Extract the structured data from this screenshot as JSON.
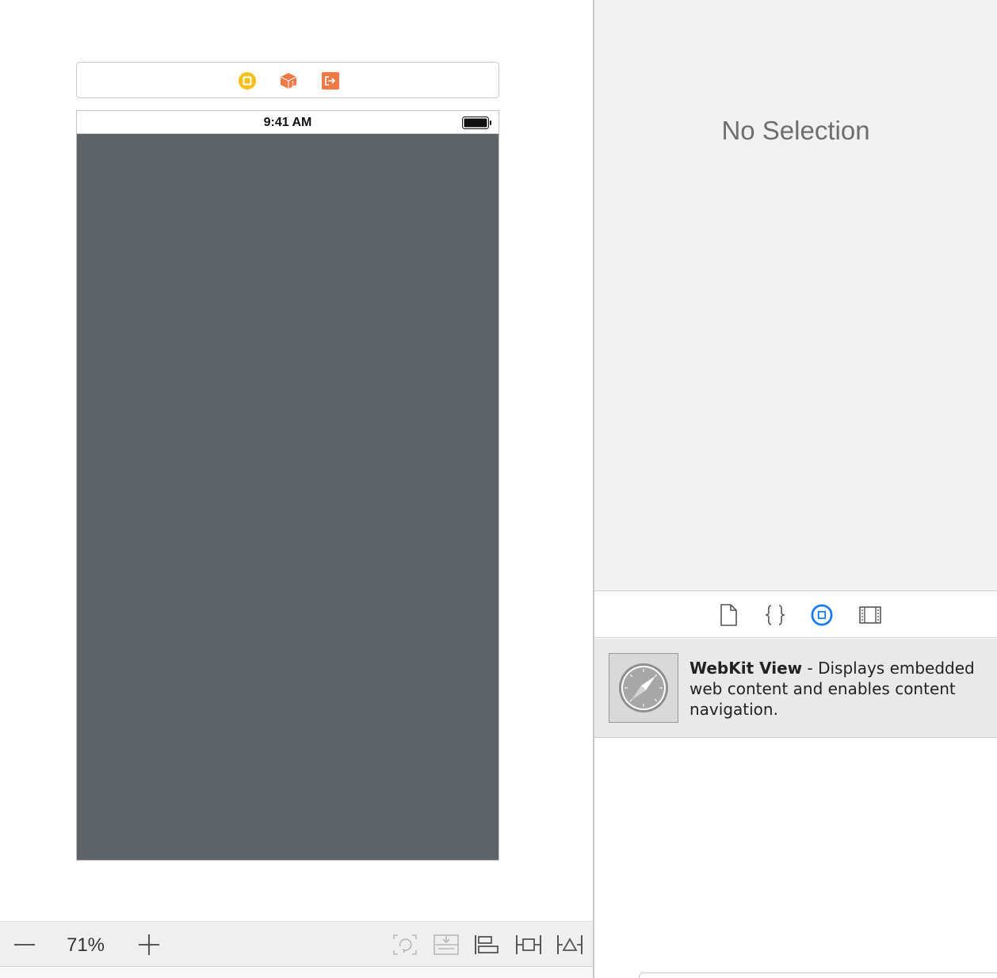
{
  "canvas": {
    "status_bar": {
      "time": "9:41 AM"
    },
    "scene_dock": {
      "icons": [
        "view-controller-icon",
        "first-responder-icon",
        "exit-icon"
      ],
      "colors": {
        "view_controller": "#f5c018",
        "first_responder": "#ef7a45",
        "exit": "#ef7a45"
      }
    },
    "view_background": "#5d6366",
    "toolbar": {
      "zoom_level": "71%",
      "buttons": [
        "zoom-out-icon",
        "zoom-in-icon",
        "update-frames-icon",
        "embed-in-stack-icon",
        "align-icon",
        "add-constraints-icon",
        "resolve-issues-icon"
      ]
    }
  },
  "inspector": {
    "empty_message": "No Selection"
  },
  "library": {
    "tabs": [
      "file-template-icon",
      "code-snippet-icon",
      "object-library-icon",
      "media-library-icon"
    ],
    "active_tab": "object-library-icon",
    "accent": "#1a7cf0",
    "item": {
      "title": "WebKit View",
      "description": " - Displays embedded web content and enables content navigation.",
      "icon": "safari-compass-icon"
    }
  }
}
